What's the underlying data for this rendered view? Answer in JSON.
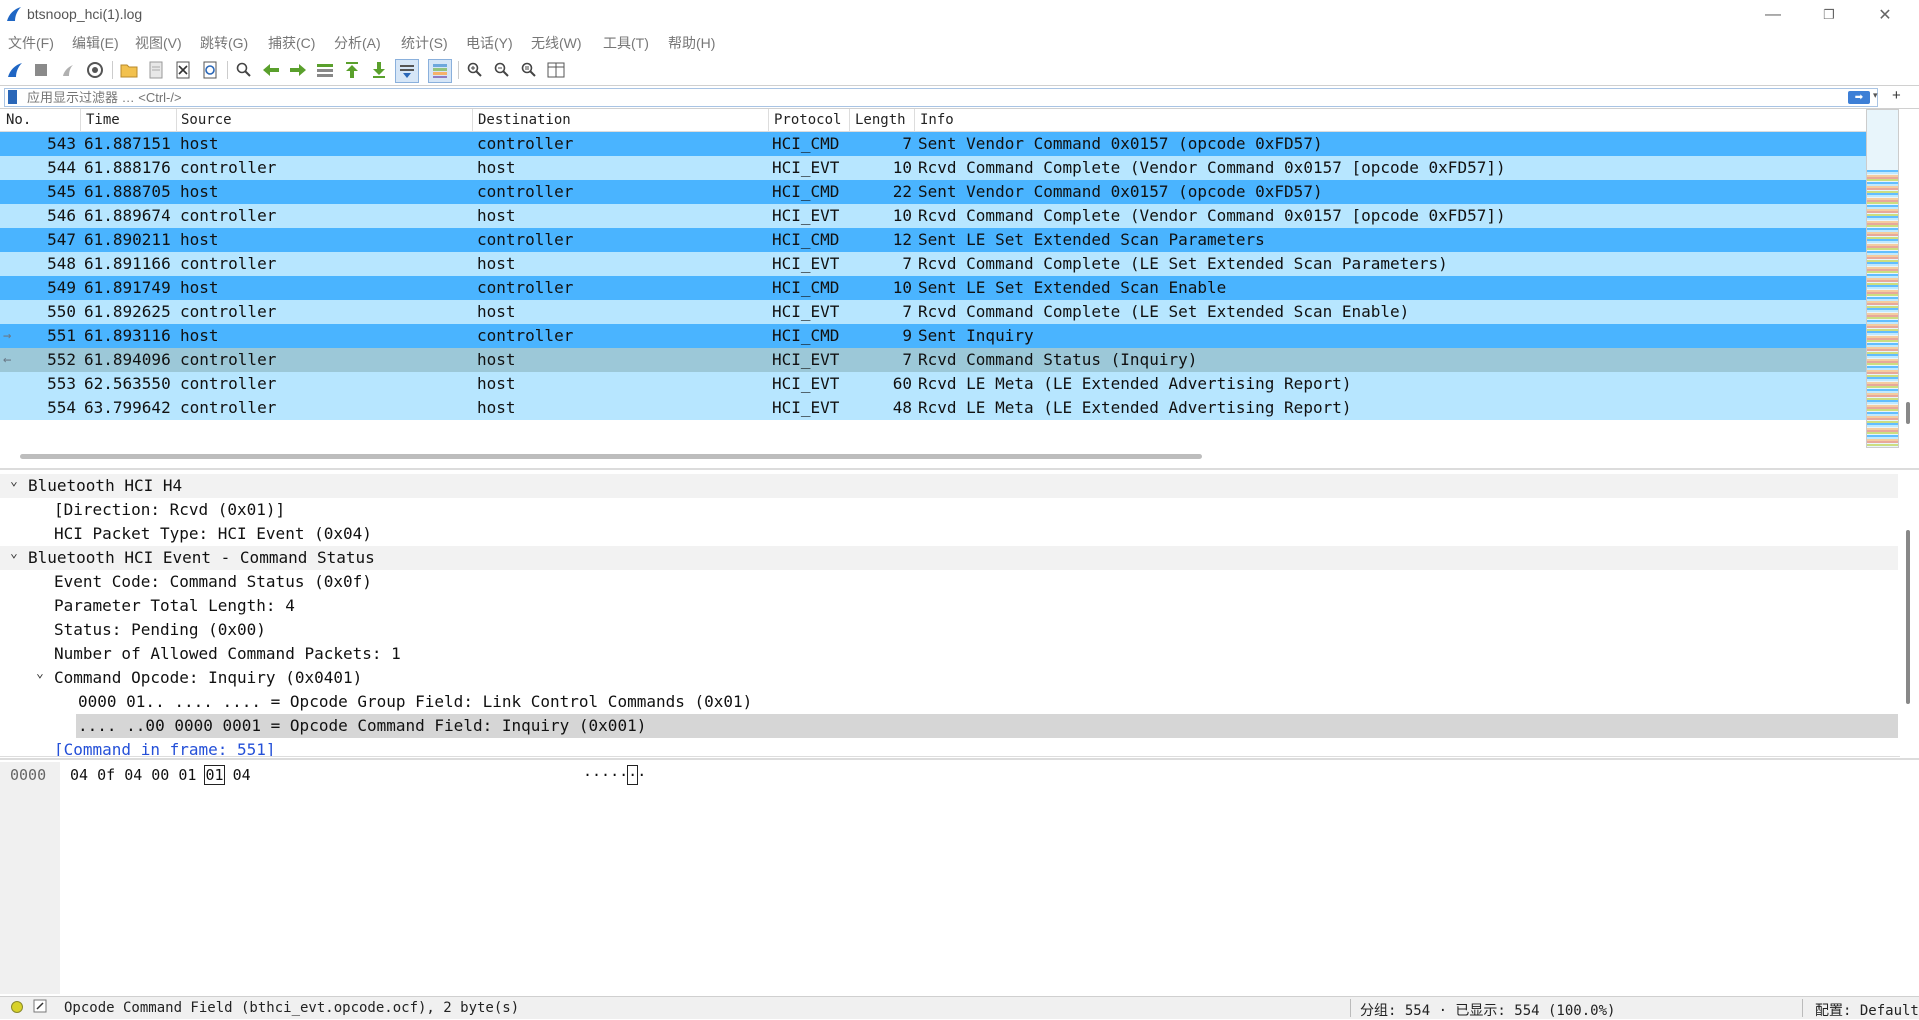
{
  "window": {
    "title": "btsnoop_hci(1).log",
    "minimize": "—",
    "restore": "❐",
    "close": "✕"
  },
  "menu": [
    "文件(F)",
    "编辑(E)",
    "视图(V)",
    "跳转(G)",
    "捕获(C)",
    "分析(A)",
    "统计(S)",
    "电话(Y)",
    "无线(W)",
    "工具(T)",
    "帮助(H)"
  ],
  "filter": {
    "placeholder": "应用显示过滤器 … <Ctrl-/>",
    "apply_icon": "arrow-right-icon",
    "add": "+"
  },
  "columns": {
    "no": "No.",
    "time": "Time",
    "source": "Source",
    "destination": "Destination",
    "protocol": "Protocol",
    "length": "Length",
    "info": "Info"
  },
  "packets": [
    {
      "no": "543",
      "time": "61.887151",
      "source": "host",
      "destination": "controller",
      "protocol": "HCI_CMD",
      "length": "7",
      "info": "Sent Vendor Command 0x0157 (opcode 0xFD57)",
      "kind": "cmd"
    },
    {
      "no": "544",
      "time": "61.888176",
      "source": "controller",
      "destination": "host",
      "protocol": "HCI_EVT",
      "length": "10",
      "info": "Rcvd Command Complete (Vendor Command 0x0157 [opcode 0xFD57])",
      "kind": "evt"
    },
    {
      "no": "545",
      "time": "61.888705",
      "source": "host",
      "destination": "controller",
      "protocol": "HCI_CMD",
      "length": "22",
      "info": "Sent Vendor Command 0x0157 (opcode 0xFD57)",
      "kind": "cmd"
    },
    {
      "no": "546",
      "time": "61.889674",
      "source": "controller",
      "destination": "host",
      "protocol": "HCI_EVT",
      "length": "10",
      "info": "Rcvd Command Complete (Vendor Command 0x0157 [opcode 0xFD57])",
      "kind": "evt"
    },
    {
      "no": "547",
      "time": "61.890211",
      "source": "host",
      "destination": "controller",
      "protocol": "HCI_CMD",
      "length": "12",
      "info": "Sent LE Set Extended Scan Parameters",
      "kind": "cmd"
    },
    {
      "no": "548",
      "time": "61.891166",
      "source": "controller",
      "destination": "host",
      "protocol": "HCI_EVT",
      "length": "7",
      "info": "Rcvd Command Complete (LE Set Extended Scan Parameters)",
      "kind": "evt"
    },
    {
      "no": "549",
      "time": "61.891749",
      "source": "host",
      "destination": "controller",
      "protocol": "HCI_CMD",
      "length": "10",
      "info": "Sent LE Set Extended Scan Enable",
      "kind": "cmd"
    },
    {
      "no": "550",
      "time": "61.892625",
      "source": "controller",
      "destination": "host",
      "protocol": "HCI_EVT",
      "length": "7",
      "info": "Rcvd Command Complete (LE Set Extended Scan Enable)",
      "kind": "evt"
    },
    {
      "no": "551",
      "time": "61.893116",
      "source": "host",
      "destination": "controller",
      "protocol": "HCI_CMD",
      "length": "9",
      "info": "Sent Inquiry",
      "kind": "cmd",
      "related": "→"
    },
    {
      "no": "552",
      "time": "61.894096",
      "source": "controller",
      "destination": "host",
      "protocol": "HCI_EVT",
      "length": "7",
      "info": "Rcvd Command Status (Inquiry)",
      "kind": "sel",
      "related": "←"
    },
    {
      "no": "553",
      "time": "62.563550",
      "source": "controller",
      "destination": "host",
      "protocol": "HCI_EVT",
      "length": "60",
      "info": "Rcvd LE Meta (LE Extended Advertising Report)",
      "kind": "evt"
    },
    {
      "no": "554",
      "time": "63.799642",
      "source": "controller",
      "destination": "host",
      "protocol": "HCI_EVT",
      "length": "48",
      "info": "Rcvd LE Meta (LE Extended Advertising Report)",
      "kind": "evt"
    }
  ],
  "details": [
    {
      "text": "Bluetooth HCI H4",
      "level": 0,
      "expander": "⌄",
      "style": "top"
    },
    {
      "text": "[Direction: Rcvd (0x01)]",
      "level": 1
    },
    {
      "text": "HCI Packet Type: HCI Event (0x04)",
      "level": 1
    },
    {
      "text": "Bluetooth HCI Event - Command Status",
      "level": 0,
      "expander": "⌄",
      "style": "top"
    },
    {
      "text": "Event Code: Command Status (0x0f)",
      "level": 1
    },
    {
      "text": "Parameter Total Length: 4",
      "level": 1
    },
    {
      "text": "Status: Pending (0x00)",
      "level": 1
    },
    {
      "text": "Number of Allowed Command Packets: 1",
      "level": 1
    },
    {
      "text": "Command Opcode: Inquiry (0x0401)",
      "level": 1,
      "expander": "⌄"
    },
    {
      "text": "0000 01.. .... .... = Opcode Group Field: Link Control Commands (0x01)",
      "level": 2
    },
    {
      "text": ".... ..00 0000 0001 = Opcode Command Field: Inquiry (0x001)",
      "level": 2,
      "style": "sel"
    },
    {
      "text": "[Command in frame: 551]",
      "level": 1,
      "style": "link"
    }
  ],
  "bytes": {
    "offset": "0000",
    "hex": [
      "04",
      "0f",
      "04",
      "00",
      "01",
      "01",
      "04"
    ],
    "selected_index": 5,
    "ascii": "·····",
    "ascii_sel": "·",
    "ascii_tail": "·"
  },
  "status": {
    "text": "Opcode Command Field (bthci_evt.opcode.ocf), 2 byte(s)",
    "counts": "分组: 554 · 已显示: 554 (100.0%)",
    "profile": "配置: Default"
  },
  "colors": {
    "cmd_row": "#4ab4ff",
    "evt_row": "#b7e6ff",
    "selected_row": "#9cc8d8"
  }
}
